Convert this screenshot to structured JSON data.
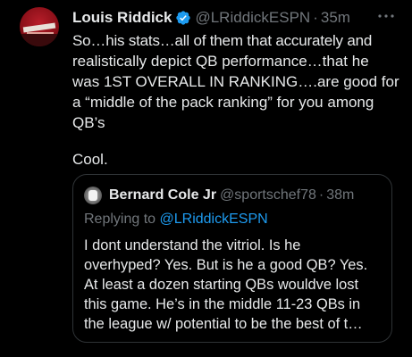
{
  "tweet": {
    "author_name": "Louis Riddick",
    "author_handle": "@LRiddickESPN",
    "separator": "·",
    "time": "35m",
    "body_lines": [
      "So…his stats…all of them that accurately and",
      "realistically depict QB performance…that he",
      "was 1ST OVERALL IN RANKING….are good for",
      "a “middle of the pack ranking” for you among",
      "QB’s"
    ],
    "closing": "Cool.",
    "verified_icon": "verified-badge-icon",
    "more_icon": "more-dots-icon",
    "accent_color": "#1d9bf0"
  },
  "quote": {
    "author_name": "Bernard Cole Jr",
    "author_handle": "@sportschef78",
    "separator": "·",
    "time": "38m",
    "replying_prefix": "Replying to",
    "replying_handle": "@LRiddickESPN",
    "body_lines": [
      "I dont understand the vitriol. Is he",
      "overhyped? Yes. But is he a good QB? Yes.",
      "At least a dozen starting QBs wouldve lost",
      "this game. He’s in the middle 11-23 QBs in",
      "the league w/ potential to be the best of t…"
    ]
  }
}
